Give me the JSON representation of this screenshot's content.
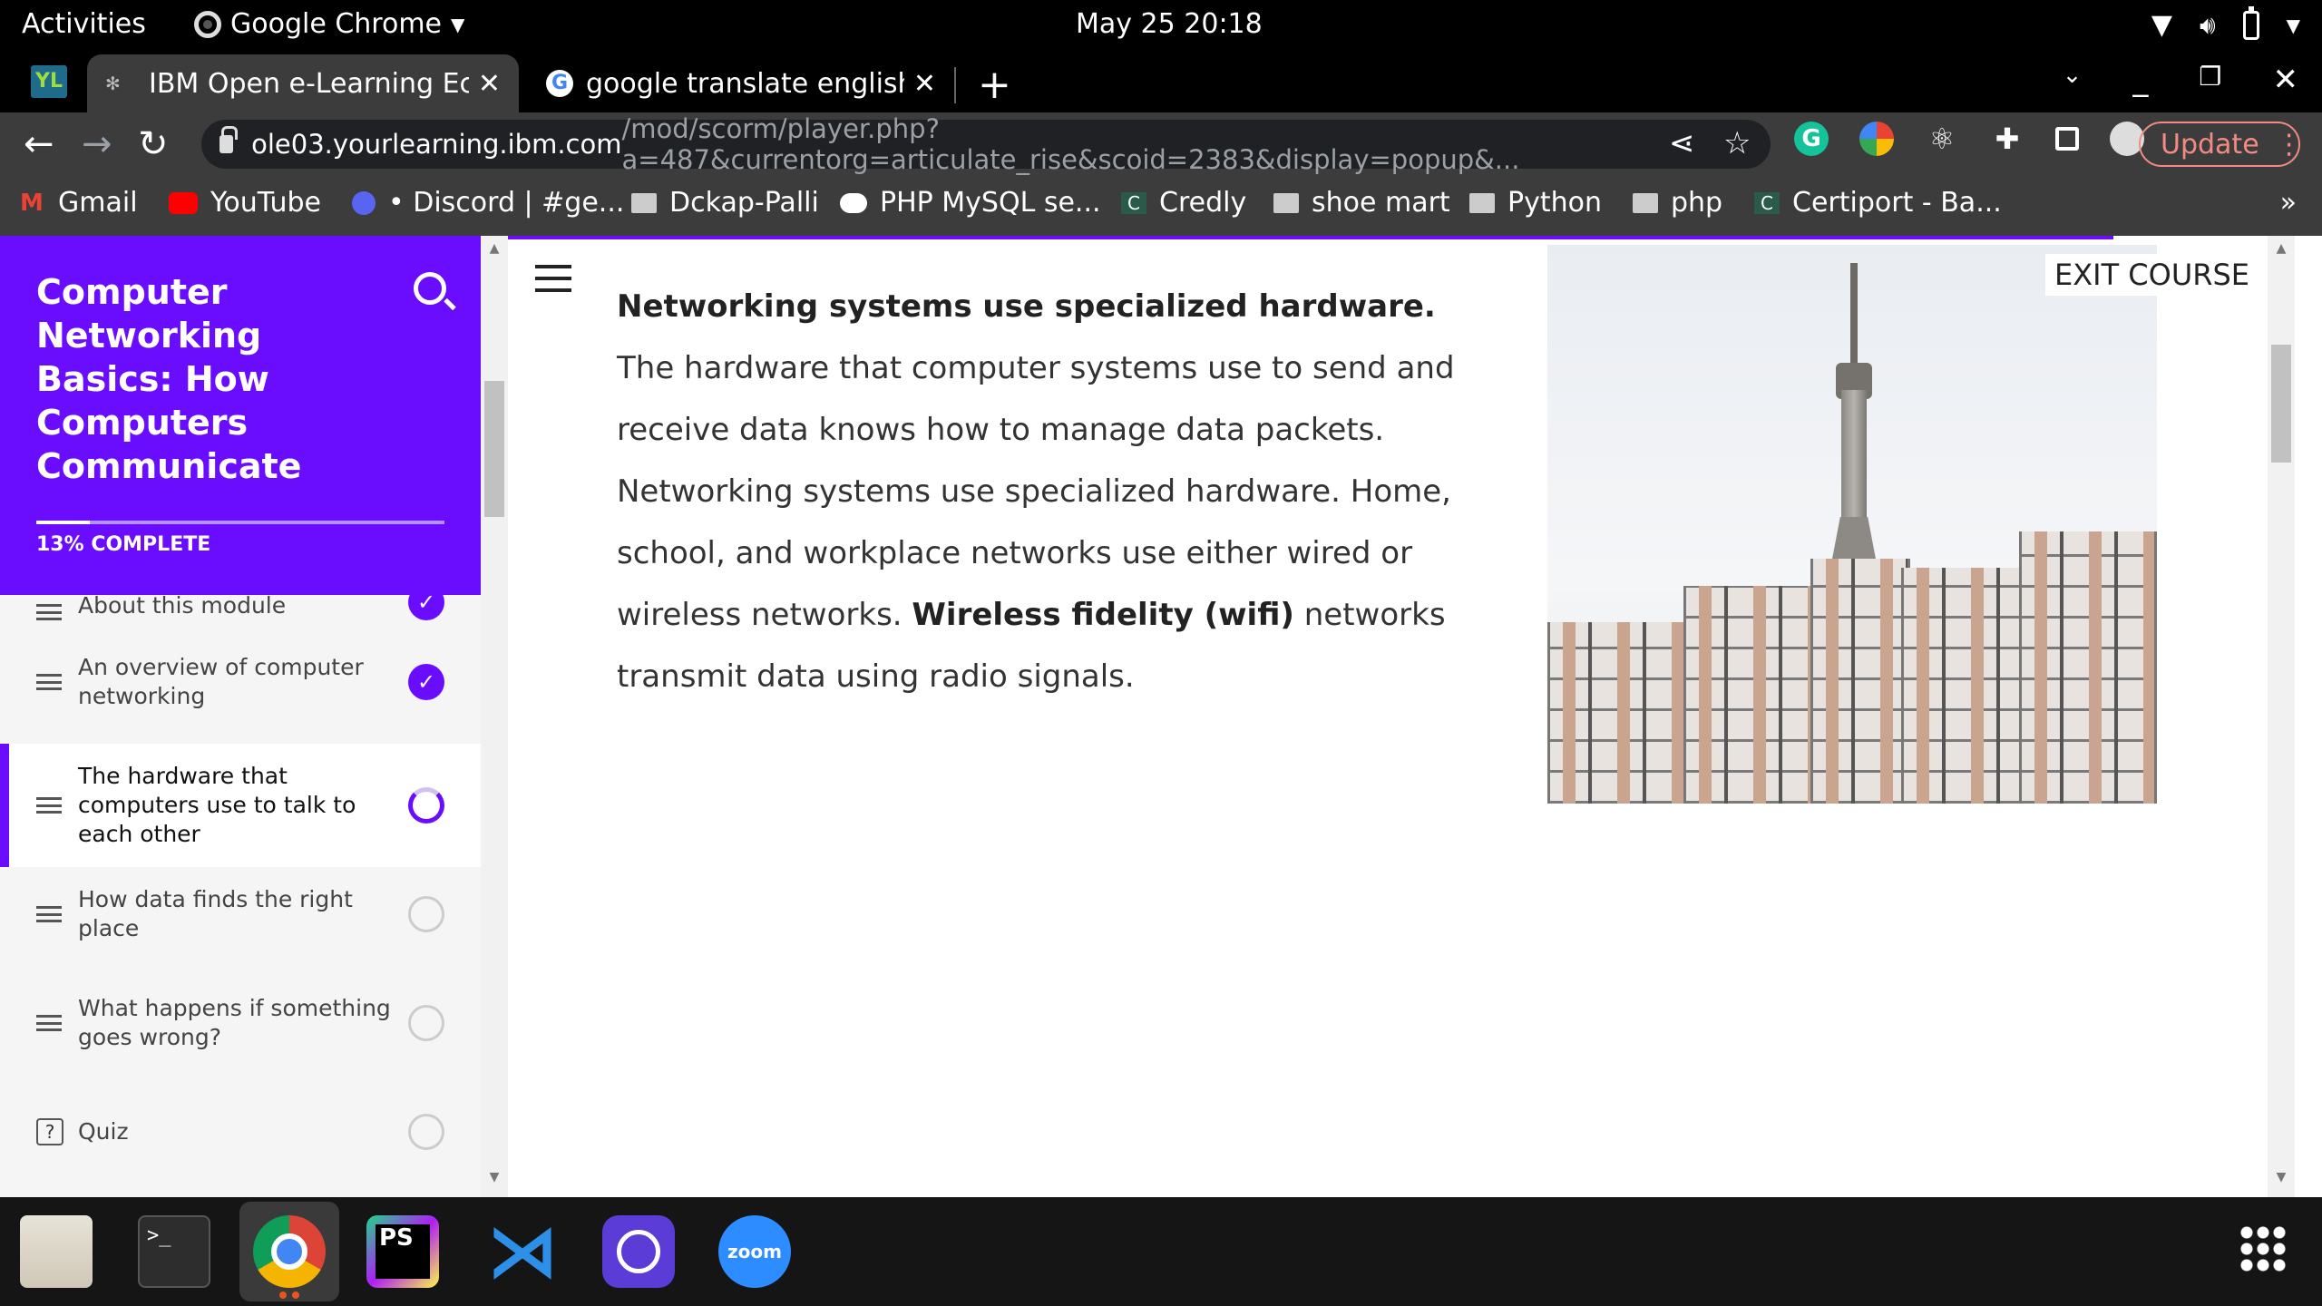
{
  "topbar": {
    "activities": "Activities",
    "app_name": "Google Chrome",
    "clock": "May 25  20:18"
  },
  "tabs": [
    {
      "title": "IBM Open e-Learning Ecos",
      "active": true
    },
    {
      "title": "google translate english t",
      "active": false
    }
  ],
  "navbar": {
    "url_host": "ole03.yourlearning.ibm.com",
    "url_path": "/mod/scorm/player.php?a=487&currentorg=articulate_rise&scoid=2383&display=popup&...",
    "update_label": "Update"
  },
  "bookmarks": [
    {
      "label": "Gmail",
      "icon": "gmail-icon"
    },
    {
      "label": "YouTube",
      "icon": "youtube-icon"
    },
    {
      "label": "• Discord | #ge...",
      "icon": "discord-icon"
    },
    {
      "label": "Dckap-Palli",
      "icon": "folder-icon"
    },
    {
      "label": "PHP MySQL se...",
      "icon": "medium-icon"
    },
    {
      "label": "Credly",
      "icon": "credly-icon"
    },
    {
      "label": "shoe mart",
      "icon": "folder-icon"
    },
    {
      "label": "Python",
      "icon": "folder-icon"
    },
    {
      "label": "php",
      "icon": "folder-icon"
    },
    {
      "label": "Certiport - Ba...",
      "icon": "certiport-icon"
    }
  ],
  "bookmarks_more": "»",
  "course": {
    "title": "Computer Networking Basics: How Computers Communicate",
    "progress_label": "13% COMPLETE",
    "progress_fraction": 0.13,
    "lessons": [
      {
        "label": "About this module",
        "status": "complete"
      },
      {
        "label": "An overview of computer networking",
        "status": "complete"
      },
      {
        "label": "The hardware that computers use to talk to each other",
        "status": "in-progress"
      },
      {
        "label": "How data finds the right place",
        "status": "not-started"
      },
      {
        "label": "What happens if something goes wrong?",
        "status": "not-started"
      },
      {
        "label": "Quiz",
        "status": "not-started"
      }
    ]
  },
  "lesson": {
    "p1_bold": "Networking systems use specialized hardware.",
    "p1_rest": " The hardware that computer systems use to send and receive data knows how to manage data packets. Networking systems use specialized hardware. Home, school, and workplace networks use either wired or wireless networks. ",
    "p2_bold": "Wireless fidelity (wifi)",
    "p2_rest": " networks transmit data using radio signals."
  },
  "exit_label": "EXIT COURSE",
  "dock": {
    "apps": [
      "files",
      "terminal",
      "chrome",
      "phpstorm",
      "vscode",
      "eclipse",
      "zoom"
    ],
    "terminal_glyph": ">_",
    "phpstorm_glyph": "PS",
    "zoom_label": "zoom"
  },
  "colors": {
    "accent": "#6a0dff",
    "update": "#f28b82"
  }
}
